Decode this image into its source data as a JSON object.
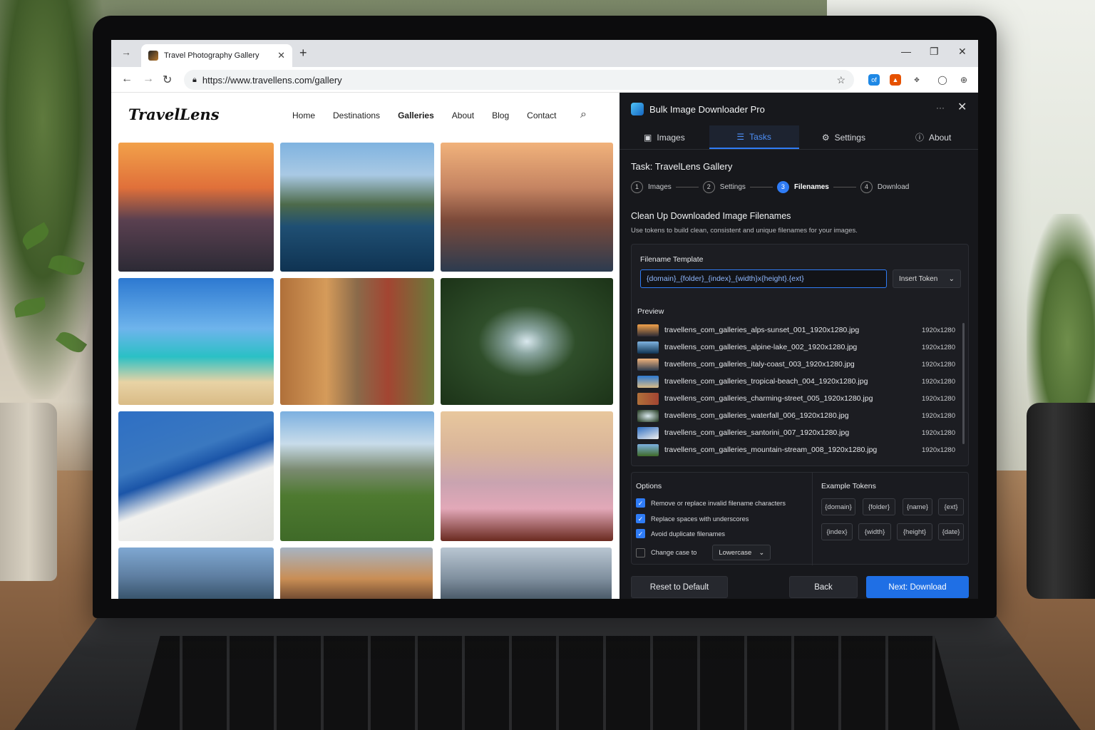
{
  "browser": {
    "tab_title": "Travel Photography Gallery",
    "url": "https://www.travellens.com/gallery"
  },
  "site": {
    "logo": "TravelLens",
    "nav": [
      "Home",
      "Destinations",
      "Galleries",
      "About",
      "Blog",
      "Contact"
    ],
    "active_nav": "Galleries"
  },
  "panel": {
    "app_title": "Bulk Image Downloader Pro",
    "tabs": [
      {
        "label": "Images",
        "icon": "image-icon"
      },
      {
        "label": "Tasks",
        "icon": "list-icon"
      },
      {
        "label": "Settings",
        "icon": "gear-icon"
      },
      {
        "label": "About",
        "icon": "info-icon"
      }
    ],
    "active_tab": "Tasks",
    "task_title": "Task: TravelLens Gallery",
    "steps": [
      {
        "num": "1",
        "label": "Images"
      },
      {
        "num": "2",
        "label": "Settings"
      },
      {
        "num": "3",
        "label": "Filenames"
      },
      {
        "num": "4",
        "label": "Download"
      }
    ],
    "active_step": "3",
    "section_title": "Clean Up Downloaded Image Filenames",
    "section_desc": "Use tokens to build clean, consistent and unique filenames for your images.",
    "template_label": "Filename Template",
    "template_value": "{domain}_{folder}_{index}_{width}x{height}.{ext}",
    "insert_token": "Insert Token",
    "preview_label": "Preview",
    "preview": [
      {
        "name": "travellens_com_galleries_alps-sunset_001_1920x1280.jpg",
        "dim": "1920x1280"
      },
      {
        "name": "travellens_com_galleries_alpine-lake_002_1920x1280.jpg",
        "dim": "1920x1280"
      },
      {
        "name": "travellens_com_galleries_italy-coast_003_1920x1280.jpg",
        "dim": "1920x1280"
      },
      {
        "name": "travellens_com_galleries_tropical-beach_004_1920x1280.jpg",
        "dim": "1920x1280"
      },
      {
        "name": "travellens_com_galleries_charming-street_005_1920x1280.jpg",
        "dim": "1920x1280"
      },
      {
        "name": "travellens_com_galleries_waterfall_006_1920x1280.jpg",
        "dim": "1920x1280"
      },
      {
        "name": "travellens_com_galleries_santorini_007_1920x1280.jpg",
        "dim": "1920x1280"
      },
      {
        "name": "travellens_com_galleries_mountain-stream_008_1920x1280.jpg",
        "dim": "1920x1280"
      }
    ],
    "options_title": "Options",
    "options": [
      {
        "label": "Remove or replace invalid filename characters",
        "checked": true
      },
      {
        "label": "Replace spaces with underscores",
        "checked": true
      },
      {
        "label": "Avoid duplicate filenames",
        "checked": true
      },
      {
        "label": "Change case to",
        "checked": false
      }
    ],
    "case_value": "Lowercase",
    "tokens_title": "Example Tokens",
    "tokens": [
      "{domain}",
      "{folder}",
      "{name}",
      "{ext}",
      "{index}",
      "{width}",
      "{height}",
      "{date}"
    ],
    "buttons": {
      "reset": "Reset to Default",
      "back": "Back",
      "next": "Next: Download"
    }
  },
  "colors": {
    "accent": "#2f7cf6",
    "panel_bg": "#17181c"
  }
}
